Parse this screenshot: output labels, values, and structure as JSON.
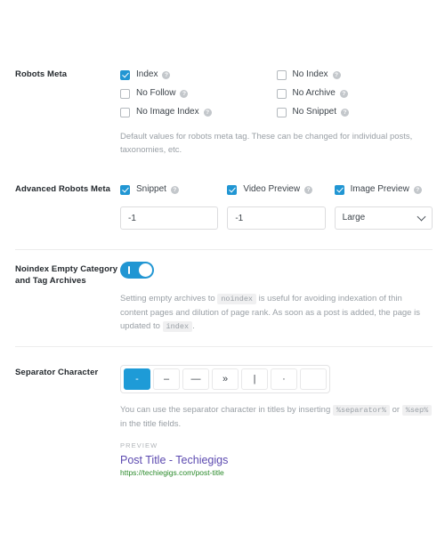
{
  "sections": {
    "robots_meta": {
      "label": "Robots Meta",
      "checkboxes_left": [
        {
          "label": "Index",
          "checked": true
        },
        {
          "label": "No Follow",
          "checked": false
        },
        {
          "label": "No Image Index",
          "checked": false
        }
      ],
      "checkboxes_right": [
        {
          "label": "No Index",
          "checked": false
        },
        {
          "label": "No Archive",
          "checked": false
        },
        {
          "label": "No Snippet",
          "checked": false
        }
      ],
      "help_text": "Default values for robots meta tag. These can be changed for individual posts, taxonomies, etc."
    },
    "advanced_robots_meta": {
      "label": "Advanced Robots Meta",
      "columns": [
        {
          "label": "Snippet",
          "checked": true,
          "value": "-1",
          "control": "text"
        },
        {
          "label": "Video Preview",
          "checked": true,
          "value": "-1",
          "control": "text"
        },
        {
          "label": "Image Preview",
          "checked": true,
          "value": "Large",
          "control": "select"
        }
      ]
    },
    "noindex_empty": {
      "label": "Noindex Empty Category and Tag Archives",
      "toggle_on": true,
      "help_text_part1": "Setting empty archives to",
      "code1": "noindex",
      "help_text_part2": "is useful for avoiding indexation of thin content pages and dilution of page rank. As soon as a post is added, the page is updated to",
      "code2": "index",
      "help_text_part3": "."
    },
    "separator": {
      "label": "Separator Character",
      "options": [
        {
          "glyph": "-",
          "active": true
        },
        {
          "glyph": "–",
          "active": false
        },
        {
          "glyph": "—",
          "active": false
        },
        {
          "glyph": "»",
          "active": false
        },
        {
          "glyph": "|",
          "active": false
        },
        {
          "glyph": "·",
          "active": false
        },
        {
          "glyph": "",
          "active": false
        }
      ],
      "help_text_part1": "You can use the separator character in titles by inserting",
      "code1": "%separator%",
      "help_text_part2": "or",
      "code2": "%sep%",
      "help_text_part3": "in the title fields.",
      "preview_kicker": "PREVIEW",
      "preview_title": "Post Title - Techiegigs",
      "preview_url": "https://techiegigs.com/post-title"
    }
  },
  "icons": {
    "help": "?"
  },
  "colors": {
    "accent": "#2196d3",
    "preview_title": "#5c4ab0",
    "preview_url": "#2a8a2a",
    "muted_text": "#9aa0a6"
  }
}
